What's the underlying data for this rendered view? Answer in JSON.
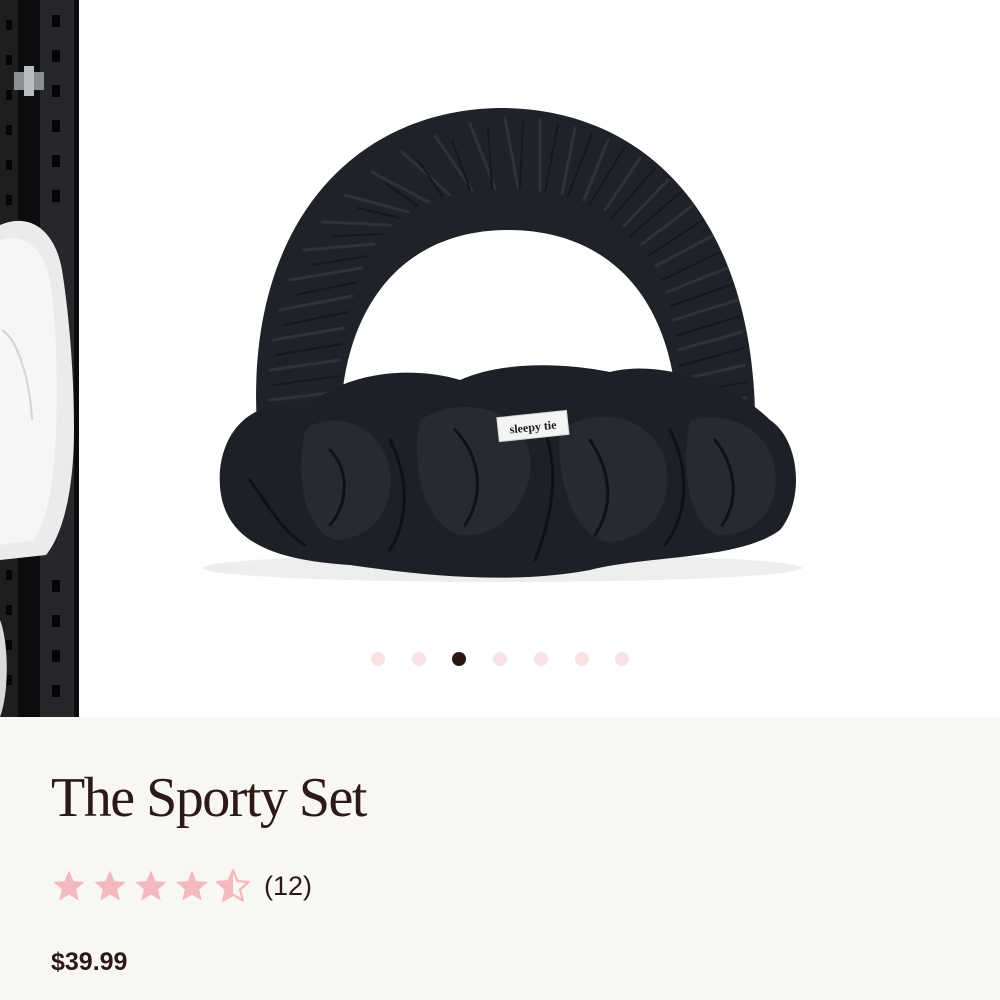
{
  "gallery": {
    "product_tag": "sleepy tie",
    "slide_count": 7,
    "active_slide": 3
  },
  "product": {
    "title": "The Sporty Set",
    "rating": 4.5,
    "rating_max": 5,
    "review_count": "(12)",
    "price": "$39.99"
  },
  "colors": {
    "text": "#2b1a16",
    "star": "#f4b8bf",
    "dot_inactive": "#f8e3e4",
    "dot_active": "#2a1712",
    "background": "#f9f7f3"
  }
}
